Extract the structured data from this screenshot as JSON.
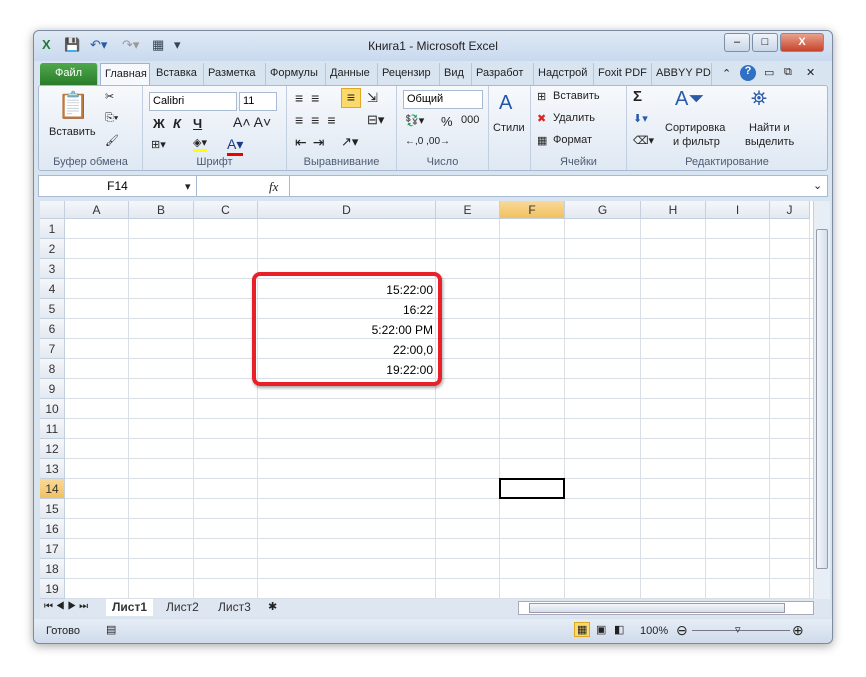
{
  "window": {
    "title": "Книга1  -  Microsoft Excel",
    "min": "–",
    "max": "□",
    "close": "X"
  },
  "tabs": [
    "Файл",
    "Главная",
    "Вставка",
    "Разметка",
    "Формулы",
    "Данные",
    "Рецензир",
    "Вид",
    "Разработ",
    "Надстрой",
    "Foxit PDF",
    "ABBYY PD"
  ],
  "ribbon": {
    "clipboard": {
      "label": "Буфер обмена",
      "paste": "Вставить"
    },
    "font": {
      "label": "Шрифт",
      "name": "Calibri",
      "size": "11",
      "bold": "Ж",
      "italic": "К",
      "underline": "Ч"
    },
    "align": {
      "label": "Выравнивание"
    },
    "number": {
      "label": "Число",
      "format": "Общий",
      "percent": "%",
      "thousands": "000"
    },
    "styles": {
      "label": "Стили"
    },
    "cells": {
      "label": "Ячейки",
      "insert": "Вставить",
      "delete": "Удалить",
      "format": "Формат"
    },
    "editing": {
      "label": "Редактирование",
      "sigma": "Σ",
      "sort1": "Сортировка",
      "sort2": "и фильтр",
      "find1": "Найти и",
      "find2": "выделить"
    }
  },
  "formula_bar": {
    "name_box": "F14",
    "fx": "fx",
    "value": ""
  },
  "columns": [
    "A",
    "B",
    "C",
    "D",
    "E",
    "F",
    "G",
    "H",
    "I",
    "J"
  ],
  "rows": [
    "1",
    "2",
    "3",
    "4",
    "5",
    "6",
    "7",
    "8",
    "9",
    "10",
    "11",
    "12",
    "13",
    "14",
    "15",
    "16",
    "17",
    "18",
    "19"
  ],
  "cells": {
    "D4": "15:22:00",
    "D5": "16:22",
    "D6": "5:22:00 PM",
    "D7": "22:00,0",
    "D8": "19:22:00"
  },
  "active_cell": "F14",
  "sheets": [
    "Лист1",
    "Лист2",
    "Лист3"
  ],
  "status": {
    "ready": "Готово",
    "zoom": "100%"
  },
  "colors": {
    "highlight": "#e8202a",
    "file_tab": "#2a7d2b"
  }
}
